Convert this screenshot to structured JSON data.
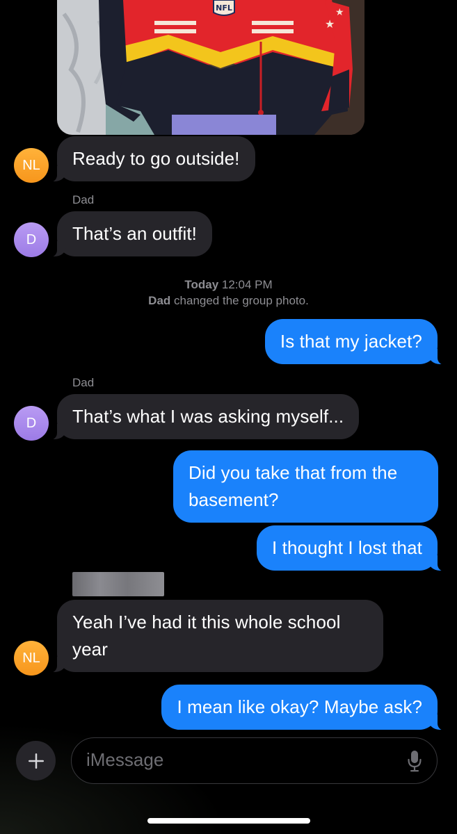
{
  "conversation": {
    "messages": [
      {
        "sender_initials": "NL",
        "text": "Ready to go outside!"
      },
      {
        "sender_name": "Dad",
        "sender_initials": "D",
        "text": "That’s an outfit!"
      },
      {
        "timestamp_day": "Today",
        "timestamp_time": "12:04 PM",
        "event_actor": "Dad",
        "event_text": "changed the group photo."
      },
      {
        "text": "Is that my jacket?"
      },
      {
        "sender_name": "Dad",
        "sender_initials": "D",
        "text": "That’s what I was asking myself..."
      },
      {
        "text": "Did you take that from the basement?"
      },
      {
        "text": "I thought I lost that"
      },
      {
        "sender_initials": "NL",
        "text": "Yeah I’ve had it this whole school year"
      },
      {
        "text": "I mean like okay? Maybe ask?"
      }
    ]
  },
  "photo": {
    "jacket_logo_text": "NFL"
  },
  "composer": {
    "placeholder": "iMessage",
    "add_icon": "plus-icon",
    "mic_icon": "microphone-icon"
  },
  "colors": {
    "outgoing_bubble": "#1a82fb",
    "incoming_bubble": "#26252a",
    "avatar_nl": "#f7961c",
    "avatar_d": "#9c7be6"
  }
}
